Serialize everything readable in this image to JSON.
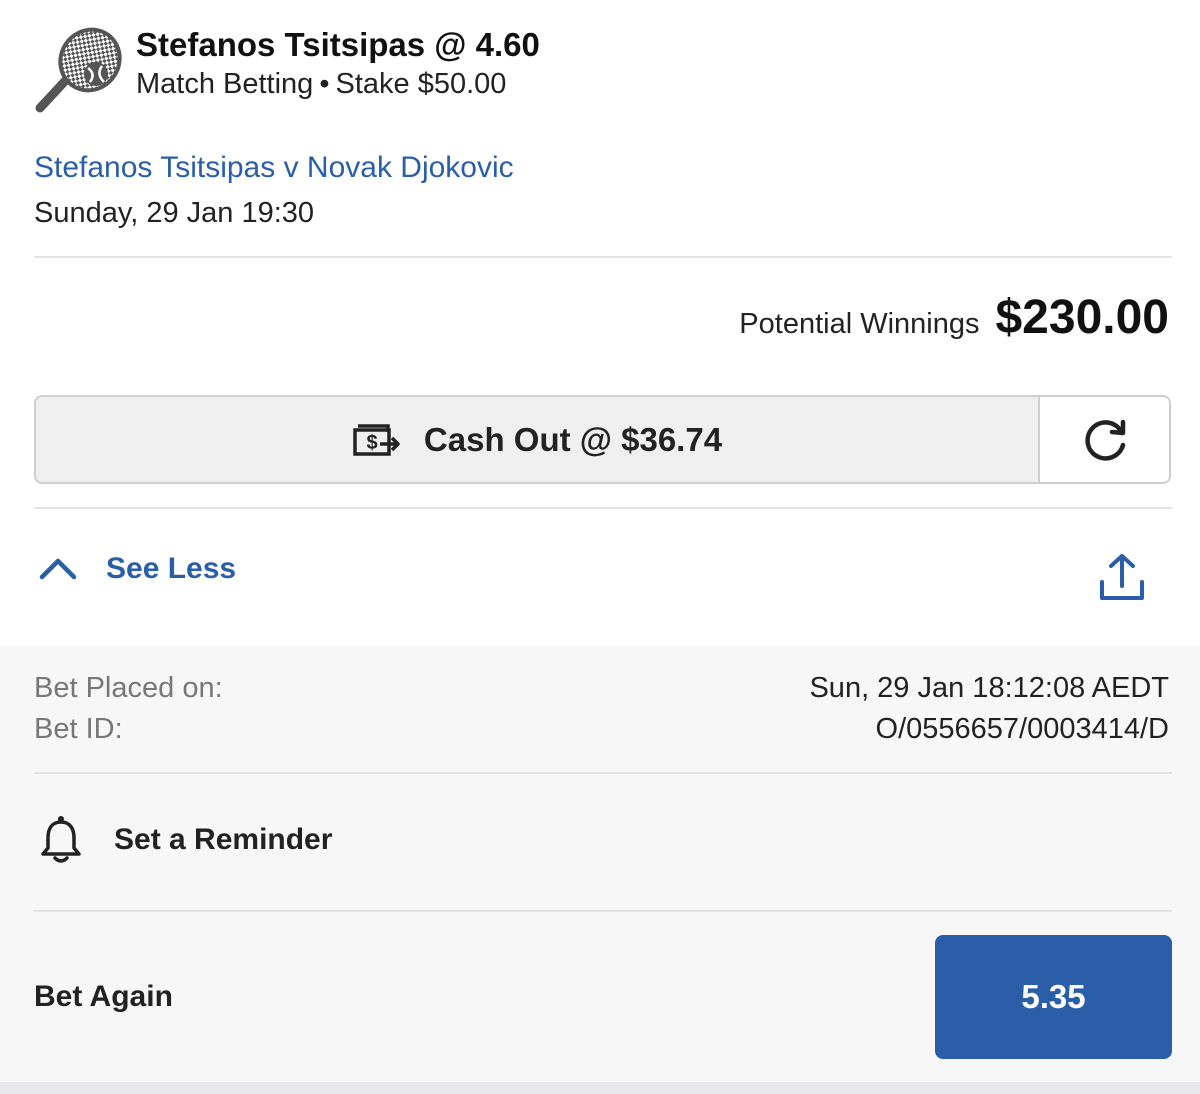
{
  "bet": {
    "title": "Stefanos Tsitsipas @ 4.60",
    "market": "Match Betting",
    "separator": "•",
    "stake": "Stake $50.00",
    "sport_icon": "tennis-racket-icon"
  },
  "event": {
    "name": "Stefanos Tsitsipas v Novak Djokovic",
    "datetime": "Sunday, 29 Jan 19:30"
  },
  "winnings": {
    "label": "Potential Winnings",
    "amount": "$230.00"
  },
  "cashout": {
    "label": "Cash Out @ $36.74",
    "icon": "cash-out-icon",
    "refresh_icon": "refresh-icon"
  },
  "details_toggle": {
    "label": "See Less",
    "icon": "chevron-up-icon",
    "share_icon": "share-icon"
  },
  "details": {
    "placed_label": "Bet Placed on:",
    "placed_value": "Sun, 29 Jan 18:12:08 AEDT",
    "id_label": "Bet ID:",
    "id_value": "O/0556657/0003414/D"
  },
  "reminder": {
    "label": "Set a Reminder",
    "icon": "bell-icon"
  },
  "bet_again": {
    "label": "Bet Again",
    "odds": "5.35"
  },
  "colors": {
    "accent": "#2a5ea8",
    "details_background": "#f7f7f7"
  }
}
